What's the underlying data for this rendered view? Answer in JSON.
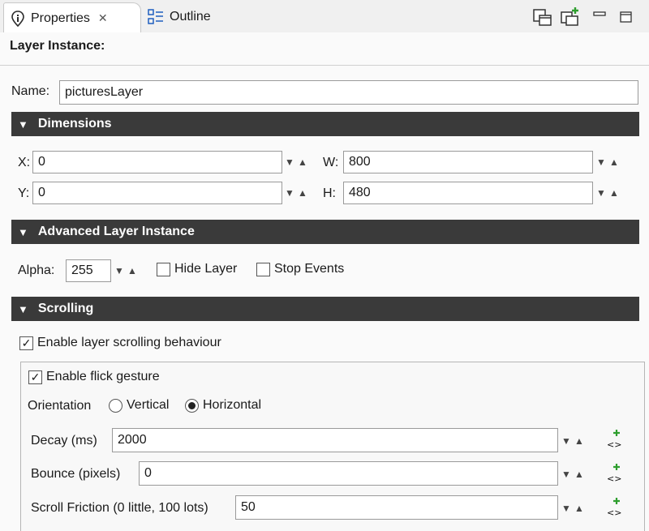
{
  "tabs": [
    {
      "label": "Properties",
      "icon": "properties-icon",
      "active": true,
      "closable": true
    },
    {
      "label": "Outline",
      "icon": "outline-icon",
      "active": false
    }
  ],
  "toolbar": {
    "icons": [
      "new-view-icon",
      "new-instance-icon",
      "minimize-icon",
      "maximize-icon"
    ]
  },
  "header": {
    "title": "Layer Instance:"
  },
  "name_field": {
    "label": "Name:",
    "value": "picturesLayer"
  },
  "sections": {
    "dimensions": "Dimensions",
    "advanced": "Advanced Layer Instance",
    "scrolling": "Scrolling"
  },
  "dimensions": {
    "x": {
      "label": "X:",
      "value": "0"
    },
    "y": {
      "label": "Y:",
      "value": "0"
    },
    "w": {
      "label": "W:",
      "value": "800"
    },
    "h": {
      "label": "H:",
      "value": "480"
    }
  },
  "advanced": {
    "alpha_label": "Alpha:",
    "alpha_value": "255",
    "hide_layer": {
      "label": "Hide Layer",
      "checked": false
    },
    "stop_events": {
      "label": "Stop Events",
      "checked": false
    }
  },
  "scrolling": {
    "enable_scrolling": {
      "label": "Enable layer scrolling behaviour",
      "checked": true
    },
    "enable_flick": {
      "label": "Enable flick gesture",
      "checked": true
    },
    "orientation_label": "Orientation",
    "orientation_options": [
      "Vertical",
      "Horizontal"
    ],
    "orientation_selected": "Horizontal",
    "decay": {
      "label": "Decay (ms)",
      "value": "2000"
    },
    "bounce": {
      "label": "Bounce (pixels)",
      "value": "0"
    },
    "friction": {
      "label": "Scroll Friction (0 little, 100 lots)",
      "value": "50"
    }
  },
  "colors": {
    "section_bg": "#3a3a3a",
    "accent_green": "#2e9e2e"
  }
}
